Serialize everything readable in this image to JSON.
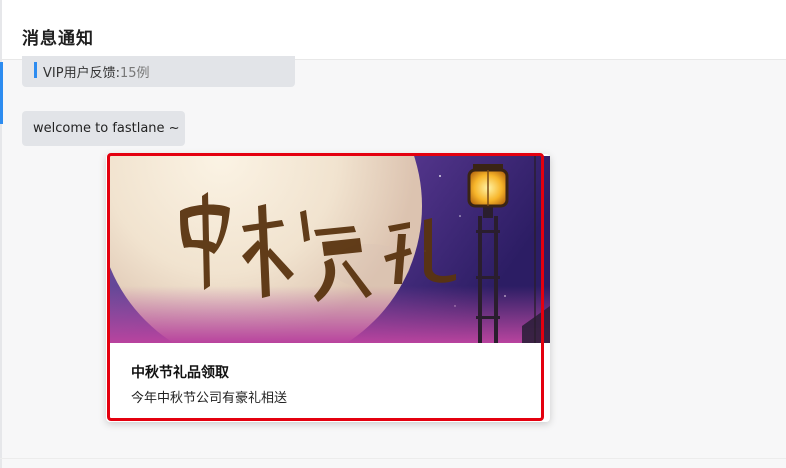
{
  "header": {
    "title": "消息通知"
  },
  "messages": {
    "feedback": {
      "label": "VIP用户反馈:",
      "count": "15例"
    },
    "welcome": {
      "text": "welcome to fastlane ~"
    }
  },
  "card": {
    "banner_calligraphy": "中秋豪礼",
    "title": "中秋节礼品领取",
    "description": "今年中秋节公司有豪礼相送"
  },
  "colors": {
    "accent_blue": "#2d8cf0",
    "highlight_red": "#e4000f",
    "bubble_gray": "#e2e4e8"
  }
}
